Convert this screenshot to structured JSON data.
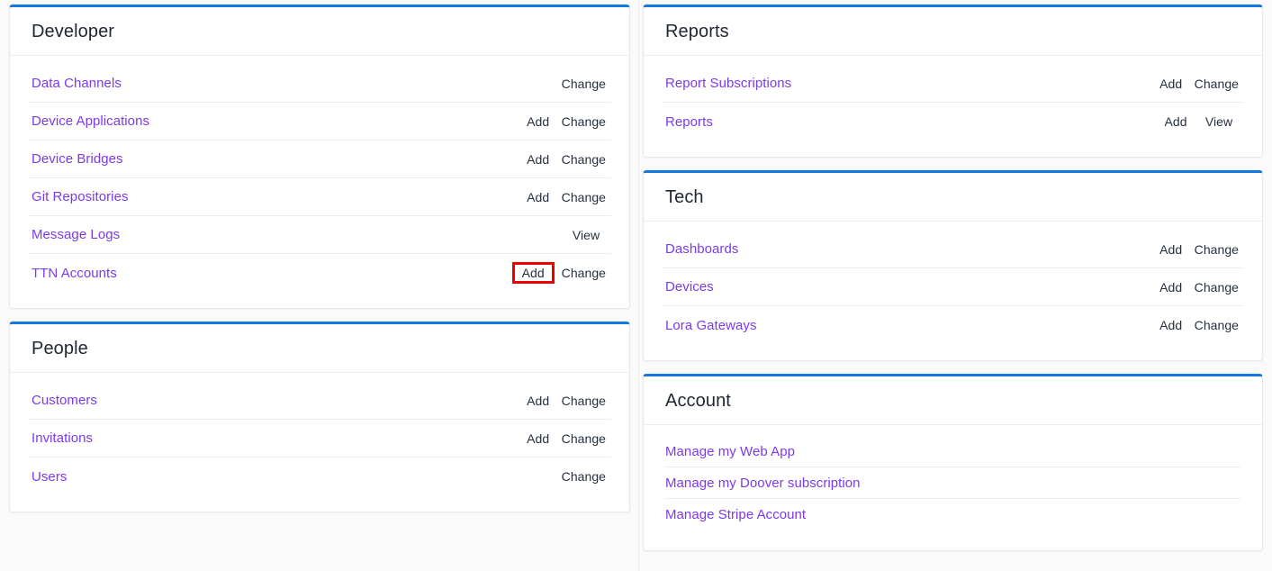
{
  "theme": {
    "accent": "#1578e0",
    "link": "#7c3aed",
    "action_text": "#25303f",
    "page_background": "#fafafa",
    "card_background": "#ffffff",
    "highlight_border": "#ee0000"
  },
  "left_column": {
    "cards": [
      {
        "title": "Developer",
        "rows": [
          {
            "name": "Data Channels",
            "add": "",
            "change": "Change"
          },
          {
            "name": "Device Applications",
            "add": "Add",
            "change": "Change"
          },
          {
            "name": "Device Bridges",
            "add": "Add",
            "change": "Change"
          },
          {
            "name": "Git Repositories",
            "add": "Add",
            "change": "Change"
          },
          {
            "name": "Message Logs",
            "add": "",
            "change": "View"
          },
          {
            "name": "TTN Accounts",
            "add": "Add",
            "change": "Change",
            "highlight": "add"
          }
        ]
      },
      {
        "title": "People",
        "rows": [
          {
            "name": "Customers",
            "add": "Add",
            "change": "Change"
          },
          {
            "name": "Invitations",
            "add": "Add",
            "change": "Change"
          },
          {
            "name": "Users",
            "add": "",
            "change": "Change"
          }
        ]
      }
    ]
  },
  "right_column": {
    "cards": [
      {
        "title": "Reports",
        "rows": [
          {
            "name": "Report Subscriptions",
            "add": "Add",
            "change": "Change"
          },
          {
            "name": "Reports",
            "add": "Add",
            "change": "View"
          }
        ]
      },
      {
        "title": "Tech",
        "rows": [
          {
            "name": "Dashboards",
            "add": "Add",
            "change": "Change"
          },
          {
            "name": "Devices",
            "add": "Add",
            "change": "Change"
          },
          {
            "name": "Lora Gateways",
            "add": "Add",
            "change": "Change"
          }
        ]
      },
      {
        "title": "Account",
        "links": [
          {
            "name": "Manage my Web App"
          },
          {
            "name": "Manage my Doover subscription"
          },
          {
            "name": "Manage Stripe Account"
          }
        ]
      }
    ]
  }
}
